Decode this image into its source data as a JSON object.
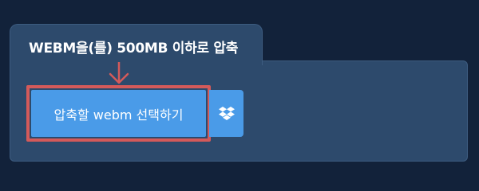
{
  "tab": {
    "title": "WEBM을(를) 500MB 이하로 압축"
  },
  "upload": {
    "select_button_label": "압축할 webm 선택하기",
    "dropbox_icon": "dropbox-icon"
  },
  "colors": {
    "page_background": "#12223a",
    "panel_background": "#2d4a6c",
    "button_blue": "#4a9be8",
    "highlight_red": "#d45a5a"
  }
}
